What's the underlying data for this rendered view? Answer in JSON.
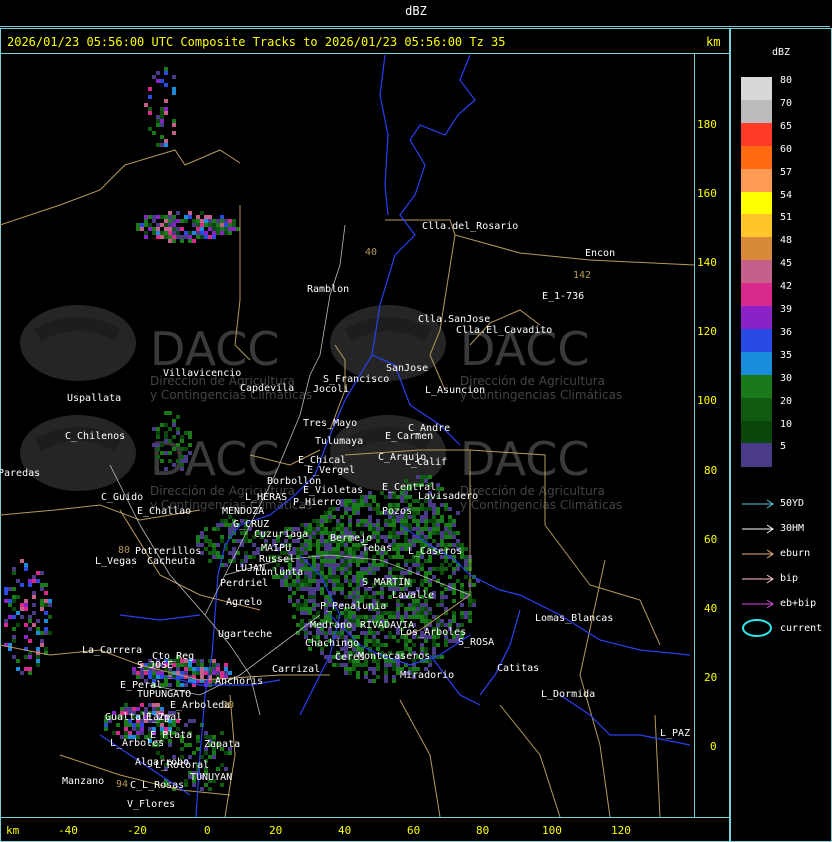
{
  "window": {
    "title": "dBZ"
  },
  "header": {
    "text": "2026/01/23 05:56:00 UTC Composite Tracks to 2026/01/23 05:56:00 Tz 35",
    "unit_top": "km",
    "unit_bottom": "km"
  },
  "axes": {
    "y_ticks": [
      "180",
      "160",
      "140",
      "120",
      "100",
      "80",
      "60",
      "40",
      "20",
      "0"
    ],
    "x_ticks": [
      "-40",
      "-20",
      "0",
      "20",
      "40",
      "60",
      "80",
      "100",
      "120"
    ]
  },
  "legend": {
    "title": "dBZ",
    "bins": [
      {
        "label": "80",
        "color": "#d8d8d8"
      },
      {
        "label": "70",
        "color": "#bbbbbb"
      },
      {
        "label": "65",
        "color": "#ff3a26"
      },
      {
        "label": "60",
        "color": "#ff6a12"
      },
      {
        "label": "57",
        "color": "#ff9a55"
      },
      {
        "label": "54",
        "color": "#ffff00"
      },
      {
        "label": "51",
        "color": "#ffc52a"
      },
      {
        "label": "48",
        "color": "#d88a3a"
      },
      {
        "label": "45",
        "color": "#c4608a"
      },
      {
        "label": "42",
        "color": "#d82a8c"
      },
      {
        "label": "39",
        "color": "#8a22c8"
      },
      {
        "label": "36",
        "color": "#2a4ae6"
      },
      {
        "label": "35",
        "color": "#1a8cdc"
      },
      {
        "label": "30",
        "color": "#1a7a1a"
      },
      {
        "label": "20",
        "color": "#115a11"
      },
      {
        "label": "10",
        "color": "#0a450a"
      },
      {
        "label": "5",
        "color": "#4a3a88"
      }
    ],
    "tracks": [
      {
        "label": "50YD",
        "color": "#55c8d8"
      },
      {
        "label": "30HM",
        "color": "#ffffff"
      },
      {
        "label": "eburn",
        "color": "#e8b27a"
      },
      {
        "label": "bip",
        "color": "#ffc8cc"
      },
      {
        "label": "eb+bip",
        "color": "#d84ad8"
      }
    ],
    "current": {
      "label": "current",
      "color": "#2ee8e8"
    }
  },
  "watermark": {
    "logo": "DACC",
    "line1": "Dirección de Agricultura",
    "line2": "y Contingencias Climáticas"
  },
  "places": [
    "Clla.del_Rosario",
    "Encon",
    "142",
    "E_1-736",
    "Ramblon",
    "Clla.SanJose",
    "Clla.El_Cavadito",
    "Villavicencio",
    "S_Francisco",
    "SanJose",
    "Capdevila",
    "Jocoli",
    "L_Asuncion",
    "Uspallata",
    "Tres_Mayo",
    "C_Andre",
    "C_Chilenos",
    "Tulumaya",
    "E_Carmen",
    "C_Araujo",
    "Paredas",
    "E_Chical",
    "L_Calif",
    "E_Vergel",
    "Borbollon",
    "E_Central",
    "Lavisadero",
    "E_Violetas",
    "L_HERAS",
    "C_Guido",
    "P_Hierro",
    "E_Challao",
    "MENDOZA",
    "Pozos",
    "G_CRUZ",
    "Cuzuriaga",
    "Bermejo",
    "Tebas",
    "L_Caseros",
    "MAIPU",
    "Potrerillos",
    "L_Vegas",
    "Cacheuta",
    "Russel",
    "LUJAN",
    "Lunlunta",
    "S_MARTIN",
    "Perdriel",
    "Agrelo",
    "Lavalle",
    "P_Penalunia",
    "Ugarteche",
    "RIVADAVIA",
    "Lomas_Blancas",
    "S_ROSA",
    "La_Carrera",
    "Medrano",
    "Los_Arboles",
    "Catitas",
    "Cto_Reg",
    "S_JOSE",
    "Carrizal",
    "Chachingo",
    "Ceres",
    "Montecaseros",
    "E_Peral",
    "Anchoris",
    "Miradorio",
    "TUPUNGATO",
    "E_Arboleda",
    "L_Dormida",
    "Gualtallary",
    "E_Zpal",
    "L_PAZ",
    "L_Arboles",
    "E_Plata",
    "Zapata",
    "Algarrobo",
    "L_Rotoral",
    "TUNUYAN",
    "Manzano",
    "C_L_Rosas",
    "V_Flores",
    "80",
    "40",
    "94",
    "30"
  ]
}
